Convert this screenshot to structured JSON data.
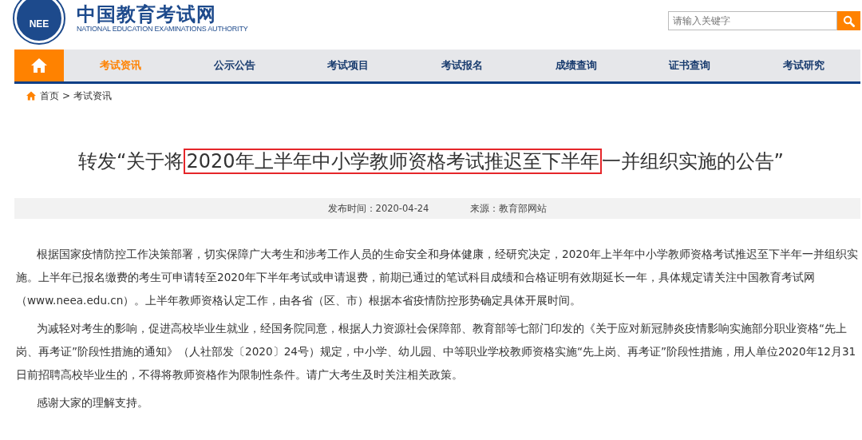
{
  "header": {
    "logo_mark": "NEE",
    "site_name": "中国教育考试网",
    "site_subtitle": "NATIONAL EDUCATION EXAMINATIONS AUTHORITY",
    "search": {
      "placeholder": "请输入关键字"
    }
  },
  "nav": [
    {
      "label": "考试资讯",
      "selected": true
    },
    {
      "label": "公示公告",
      "selected": false
    },
    {
      "label": "考试项目",
      "selected": false
    },
    {
      "label": "考试报名",
      "selected": false
    },
    {
      "label": "成绩查询",
      "selected": false
    },
    {
      "label": "证书查询",
      "selected": false
    },
    {
      "label": "考试研究",
      "selected": false
    }
  ],
  "breadcrumb": [
    "首页",
    "考试资讯"
  ],
  "breadcrumb_separator": ">",
  "article": {
    "title_parts": [
      {
        "text": "转发“关于将",
        "highlighted": false
      },
      {
        "text": "2020年上半年中小学教师资格考试推迟至下半年",
        "highlighted": true
      },
      {
        "text": "一并组织实施的公告”",
        "highlighted": false
      }
    ],
    "published": "发布时间：2020-04-24",
    "source": "来源：教育部网站",
    "paragraphs": [
      "根据国家疫情防控工作决策部署，切实保障广大考生和涉考工作人员的生命安全和身体健康，经研究决定，2020年上半年中小学教师资格考试推迟至下半年一并组织实施。上半年已报名缴费的考生可申请转至2020年下半年考试或申请退费，前期已通过的笔试科目成绩和合格证明有效期延长一年，具体规定请关注中国教育考试网（www.neea.edu.cn）。上半年教师资格认定工作，由各省（区、市）根据本省疫情防控形势确定具体开展时间。",
      "为减轻对考生的影响，促进高校毕业生就业，经国务院同意，根据人力资源社会保障部、教育部等七部门印发的《关于应对新冠肺炎疫情影响实施部分职业资格“先上岗、再考证”阶段性措施的通知》（人社部发〔2020〕24号）规定，中小学、幼儿园、中等职业学校教师资格实施“先上岗、再考证”阶段性措施，用人单位2020年12月31日前招聘高校毕业生的，不得将教师资格作为限制性条件。请广大考生及时关注相关政策。",
      "感谢大家的理解支持。"
    ]
  }
}
